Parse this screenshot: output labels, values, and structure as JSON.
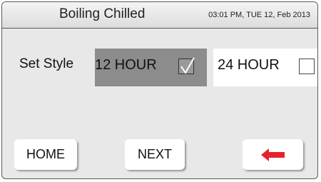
{
  "header": {
    "title": "Boiling Chilled",
    "datetime": "03:01 PM, TUE 12, Feb 2013"
  },
  "settings": {
    "label": "Set Style",
    "options": [
      {
        "label": "12 HOUR",
        "checked": true
      },
      {
        "label": "24 HOUR",
        "checked": false
      }
    ]
  },
  "buttons": {
    "home": "HOME",
    "next": "NEXT",
    "back_icon": "left-arrow-icon"
  },
  "colors": {
    "selected_option_bg": "#8c8c8c",
    "back_arrow": "#e8212b"
  }
}
